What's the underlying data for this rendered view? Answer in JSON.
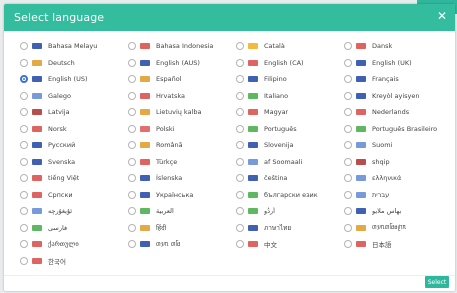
{
  "dialog": {
    "title": "Select language",
    "select_label": "Select"
  },
  "languages": [
    {
      "label": "Bahasa Melayu",
      "color": "#2b4fa8"
    },
    {
      "label": "Bahasa Indonesia",
      "color": "#d9534f"
    },
    {
      "label": "Català",
      "color": "#f0b429"
    },
    {
      "label": "Dansk",
      "color": "#d9534f"
    },
    {
      "label": "Deutsch",
      "color": "#e0a030"
    },
    {
      "label": "English (AUS)",
      "color": "#2b4fa8"
    },
    {
      "label": "English (CA)",
      "color": "#d9534f"
    },
    {
      "label": "English (UK)",
      "color": "#2b4fa8"
    },
    {
      "label": "English (US)",
      "color": "#2b4fa8",
      "selected": true
    },
    {
      "label": "Español",
      "color": "#e0a030"
    },
    {
      "label": "Filipino",
      "color": "#2b4fa8"
    },
    {
      "label": "Français",
      "color": "#2b4fa8"
    },
    {
      "label": "Galego",
      "color": "#6a8fd6"
    },
    {
      "label": "Hrvatska",
      "color": "#d9534f"
    },
    {
      "label": "Italiano",
      "color": "#4caf50"
    },
    {
      "label": "Kreyòl ayisyen",
      "color": "#2b4fa8"
    },
    {
      "label": "Latvija",
      "color": "#b03a3a"
    },
    {
      "label": "Lietuvių kalba",
      "color": "#e0a030"
    },
    {
      "label": "Magyar",
      "color": "#d9534f"
    },
    {
      "label": "Nederlands",
      "color": "#d9534f"
    },
    {
      "label": "Norsk",
      "color": "#d9534f"
    },
    {
      "label": "Polski",
      "color": "#e06060"
    },
    {
      "label": "Português",
      "color": "#4caf50"
    },
    {
      "label": "Português Brasileiro",
      "color": "#4caf50"
    },
    {
      "label": "Русский",
      "color": "#2b4fa8"
    },
    {
      "label": "Română",
      "color": "#e0a030"
    },
    {
      "label": "Slovenija",
      "color": "#2b4fa8"
    },
    {
      "label": "Suomi",
      "color": "#6a8fd6"
    },
    {
      "label": "Svenska",
      "color": "#2b4fa8"
    },
    {
      "label": "Türkçe",
      "color": "#d9534f"
    },
    {
      "label": "af Soomaali",
      "color": "#6a8fd6"
    },
    {
      "label": "shqip",
      "color": "#b03a3a"
    },
    {
      "label": "tiếng Việt",
      "color": "#d9534f"
    },
    {
      "label": "Íslenska",
      "color": "#2b4fa8"
    },
    {
      "label": "čeština",
      "color": "#2b4fa8"
    },
    {
      "label": "ελληνικά",
      "color": "#6a8fd6"
    },
    {
      "label": "Српски",
      "color": "#d9534f"
    },
    {
      "label": "Українська",
      "color": "#2b4fa8"
    },
    {
      "label": "български език",
      "color": "#4caf50"
    },
    {
      "label": "עברית",
      "color": "#6a8fd6"
    },
    {
      "label": "ئۇيغۇرچە",
      "color": "#6a8fd6"
    },
    {
      "label": "العربية",
      "color": "#4caf50"
    },
    {
      "label": "اُردُو",
      "color": "#4caf50"
    },
    {
      "label": "بهاس ملايو",
      "color": "#2b4fa8"
    },
    {
      "label": "فارسی",
      "color": "#4caf50"
    },
    {
      "label": "हिंदी",
      "color": "#e0a030"
    },
    {
      "label": "ภาษาไทย",
      "color": "#2b4fa8"
    },
    {
      "label": "ᥖᥭᥰᥖᥬᥳᥑᥨᥒᥰ",
      "color": "#e0a030"
    },
    {
      "label": "ქართული",
      "color": "#d9534f"
    },
    {
      "label": "ᥖᥭᥰ ᥖᥬᥳ",
      "color": "#2b4fa8"
    },
    {
      "label": "中文",
      "color": "#d9534f"
    },
    {
      "label": "日本語",
      "color": "#d9534f"
    },
    {
      "label": "한국어",
      "color": "#d9534f"
    }
  ]
}
